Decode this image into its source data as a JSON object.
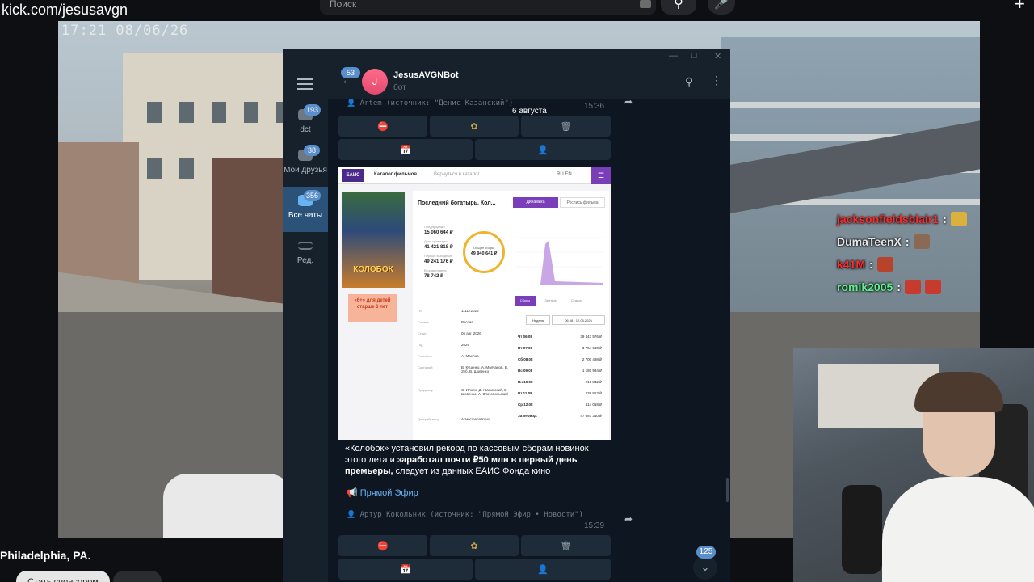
{
  "stream": {
    "channel_url": "kick.com/jesusavgn",
    "timestamp": "17:21 08/06/26",
    "location": "Philadelphia, PA.",
    "follow_label": "Стать спонсором",
    "search_placeholder": "Поиск"
  },
  "chat_overlay": [
    {
      "user": "jacksonfieldsblair1",
      "color": "#ff2a2a"
    },
    {
      "user": "DumaTeenX",
      "color": "#e6e6e6"
    },
    {
      "user": "k41M",
      "color": "#ff2a2a"
    },
    {
      "user": "romik2005",
      "color": "#5cf08a"
    }
  ],
  "telegram": {
    "sidebar": {
      "folders": [
        {
          "label": "dct",
          "badge": "193"
        },
        {
          "label": "Мои друзья",
          "badge": "38"
        },
        {
          "label": "Все чаты",
          "badge": "356"
        },
        {
          "label": "Ред.",
          "badge": ""
        }
      ]
    },
    "header": {
      "unread_count": "53",
      "avatar_letter": "J",
      "bot_name": "JesusAVGNBot",
      "bot_status": "бот"
    },
    "date_chip": "6 августа",
    "message1": {
      "author": "Artem (источник: \"Денис Казанский\")",
      "time": "15:36"
    },
    "message2": {
      "caption_part1": "«Колобок» установил рекорд по кассовым сборам новинок этого лета и ",
      "caption_bold": "заработал почти ₽50 млн в первый день премьеры,",
      "caption_part2": " следует из данных ЕАИС Фонда кино",
      "link_label": "Прямой Эфир",
      "author": "Артур Кокольник (источник: \"Прямой Эфир • Новости\")",
      "time": "15:39"
    },
    "scroll_badge": "125",
    "image": {
      "logo": "ЕАИС",
      "nav_catalog": "Каталог фильмов",
      "nav_back": "Вернуться в каталог",
      "lang": "RU EN",
      "poster_title": "КОЛОБОК",
      "age_text": "«6+» для детей старше 6 лет",
      "film_title": "Последний богатырь. Кол...",
      "tab_dynamics": "Динамика",
      "tab_schedule": "Роспись фильма",
      "stats": [
        {
          "label": "Предпродажи",
          "value": "15 060 644 ₽"
        },
        {
          "label": "День премьеры",
          "value": "41 421 818 ₽"
        },
        {
          "label": "Первые выходные",
          "value": "49 241 176 ₽"
        },
        {
          "label": "Вторая неделя",
          "value": "78 742 ₽"
        }
      ],
      "ring_label": "Общие сборы",
      "ring_value": "49 940 641 ₽",
      "info": [
        {
          "label": "ПУ",
          "value": "111172026"
        },
        {
          "label": "Страна",
          "value": "Россия"
        },
        {
          "label": "Старт",
          "value": "06 авг. 2026"
        },
        {
          "label": "Год",
          "value": "2026"
        },
        {
          "label": "Режиссер",
          "value": "А. Маслов"
        },
        {
          "label": "Сценарий",
          "value": "В. Куценко, А. Молчанов, В. Зуб, В. Шовенко"
        },
        {
          "label": "Продюсер",
          "value": "Э. Илоян, Д. Жалинский, В. Шовенко, А. Злотопольский"
        },
        {
          "label": "Дистрибьютор",
          "value": "Атмосфера Кино"
        }
      ],
      "subtabs": [
        "Сборы",
        "Зрители",
        "Сеансы"
      ],
      "period_select": "Неделя",
      "period_range": "06.08 - 12.08.2026",
      "days": [
        {
          "day": "Чт 06.08",
          "value": "39 443 576 ₽"
        },
        {
          "day": "Пт 07.08",
          "value": "3 754 630 ₽"
        },
        {
          "day": "Сб 08.08",
          "value": "2 700 498 ₽"
        },
        {
          "day": "Вс 09.08",
          "value": "1 180 934 ₽"
        },
        {
          "day": "Пн 10.08",
          "value": "216 842 ₽"
        },
        {
          "day": "Вт 11.08",
          "value": "238 813 ₽"
        },
        {
          "day": "Ср 12.08",
          "value": "114 018 ₽"
        },
        {
          "day": "За период:",
          "value": "47 687 310 ₽"
        }
      ]
    }
  }
}
